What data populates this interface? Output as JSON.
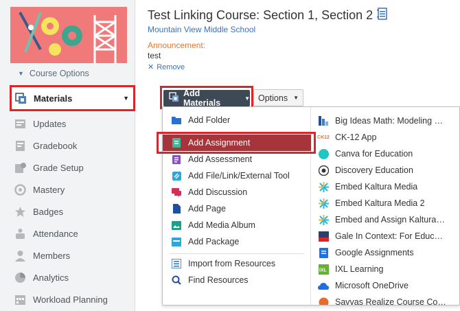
{
  "sidebar": {
    "course_options_label": "Course Options",
    "nav": [
      {
        "label": "Materials",
        "icon": "materials-icon",
        "active": true
      },
      {
        "label": "Updates",
        "icon": "updates-icon"
      },
      {
        "label": "Gradebook",
        "icon": "gradebook-icon"
      },
      {
        "label": "Grade Setup",
        "icon": "grade-setup-icon"
      },
      {
        "label": "Mastery",
        "icon": "mastery-icon"
      },
      {
        "label": "Badges",
        "icon": "badges-icon"
      },
      {
        "label": "Attendance",
        "icon": "attendance-icon"
      },
      {
        "label": "Members",
        "icon": "members-icon"
      },
      {
        "label": "Analytics",
        "icon": "analytics-icon"
      },
      {
        "label": "Workload Planning",
        "icon": "workload-planning-icon"
      }
    ]
  },
  "header": {
    "title": "Test Linking Course: Section 1, Section 2",
    "school": "Mountain View Middle School",
    "announcement_label": "Announcement:",
    "announcement_text": "test",
    "remove_label": "Remove"
  },
  "toolbar": {
    "add_materials_label": "Add Materials",
    "options_label": "Options"
  },
  "add_menu": {
    "items": [
      {
        "label": "Add Folder",
        "icon": "folder-icon"
      },
      {
        "label": "Add Assignment",
        "icon": "assignment-icon",
        "highlighted": true
      },
      {
        "label": "Add Assessment",
        "icon": "assessment-icon"
      },
      {
        "label": "Add File/Link/External Tool",
        "icon": "link-icon"
      },
      {
        "label": "Add Discussion",
        "icon": "discussion-icon"
      },
      {
        "label": "Add Page",
        "icon": "page-icon"
      },
      {
        "label": "Add Media Album",
        "icon": "media-album-icon"
      },
      {
        "label": "Add Package",
        "icon": "package-icon"
      }
    ],
    "resource_items": [
      {
        "label": "Import from Resources",
        "icon": "import-icon"
      },
      {
        "label": "Find Resources",
        "icon": "search-icon"
      }
    ],
    "apps": [
      {
        "label": "Big Ideas Math: Modeling Real Life",
        "icon": "big-ideas-math-icon"
      },
      {
        "label": "CK-12 App",
        "icon": "ck12-icon"
      },
      {
        "label": "Canva for Education",
        "icon": "canva-icon"
      },
      {
        "label": "Discovery Education",
        "icon": "discovery-education-icon"
      },
      {
        "label": "Embed Kaltura Media",
        "icon": "kaltura-icon"
      },
      {
        "label": "Embed Kaltura Media 2",
        "icon": "kaltura-icon"
      },
      {
        "label": "Embed and Assign Kaltura Media",
        "icon": "kaltura-icon"
      },
      {
        "label": "Gale In Context: For Educators",
        "icon": "gale-icon"
      },
      {
        "label": "Google Assignments",
        "icon": "google-assignments-icon"
      },
      {
        "label": "IXL Learning",
        "icon": "ixl-icon"
      },
      {
        "label": "Microsoft OneDrive",
        "icon": "onedrive-icon"
      },
      {
        "label": "Savvas Realize Course Connect",
        "icon": "savvas-icon"
      }
    ]
  },
  "colors": {
    "accent_red": "#d8262d",
    "highlight": "#a5353a",
    "link_blue": "#3a73bb",
    "announcement_orange": "#e9762b",
    "toolbar_dark": "#3d4a56"
  }
}
